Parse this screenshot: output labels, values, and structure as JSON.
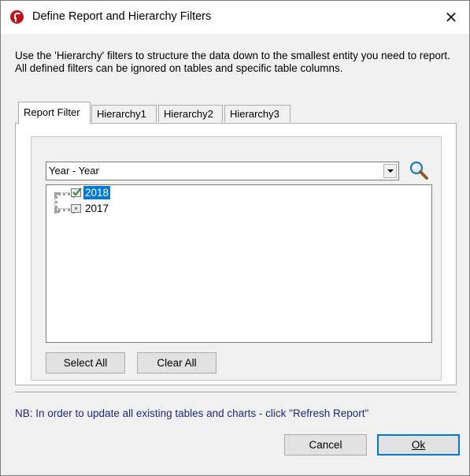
{
  "window": {
    "title": "Define Report and Hierarchy Filters",
    "close_label": "✕"
  },
  "description": "Use the 'Hierarchy' filters to structure the data down to the smallest entity you need to report. All defined filters can be ignored on tables and specific table columns.",
  "tabs": [
    {
      "label": "Report Filter",
      "active": true
    },
    {
      "label": "Hierarchy1",
      "active": false
    },
    {
      "label": "Hierarchy2",
      "active": false
    },
    {
      "label": "Hierarchy3",
      "active": false
    }
  ],
  "filter": {
    "field_selected": "Year - Year",
    "values": [
      {
        "label": "2018",
        "checked": true,
        "selected": true
      },
      {
        "label": "2017",
        "checked": false,
        "selected": false
      }
    ],
    "select_all_label": "Select All",
    "clear_all_label": "Clear All"
  },
  "footer": {
    "note": "NB: In order to update all existing tables and charts - click \"Refresh Report\"",
    "cancel_label": "Cancel",
    "ok_label": "Ok"
  },
  "icons": {
    "app": "app-logo-icon",
    "search": "magnifier-icon",
    "dropdown": "chevron-down-icon",
    "close": "close-icon"
  },
  "colors": {
    "selection": "#0078d7",
    "note_text": "#1e2a78",
    "brand": "#c1121f"
  }
}
